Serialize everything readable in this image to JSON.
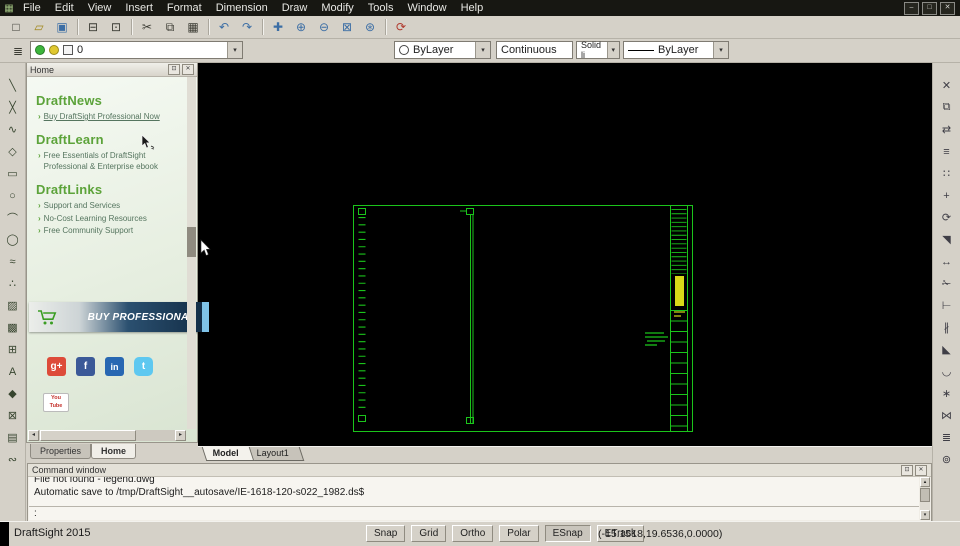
{
  "app": {
    "icon": "▦"
  },
  "menu": {
    "items": [
      "File",
      "Edit",
      "View",
      "Insert",
      "Format",
      "Dimension",
      "Draw",
      "Modify",
      "Tools",
      "Window",
      "Help"
    ]
  },
  "window_controls": {
    "minimize": "‒",
    "maximize": "□",
    "close": "✕"
  },
  "icons": {
    "new": "□",
    "open": "▱",
    "save": "▣",
    "print": "⊟",
    "print_preview": "⊡",
    "cut": "✂",
    "copy": "⧉",
    "paste": "▦",
    "undo": "↶",
    "redo": "↷",
    "pan": "✚",
    "zoom_in": "⊕",
    "zoom_out": "⊖",
    "zoom_window": "⊠",
    "zoom_fit": "⊛",
    "refresh": "⟳",
    "layers": "≣",
    "dropdown_arrow": "▾",
    "pin": "⊡",
    "close_small": "✕",
    "scroll_left": "◂",
    "scroll_right": "▸",
    "scroll_up": "▴",
    "scroll_down": "▾"
  },
  "toolbar2": {
    "layer_value": "0",
    "line_color": "ByLayer",
    "line_style": "Continuous",
    "line_weight": "Solid li",
    "line_pattern": "ByLayer"
  },
  "left_tools": [
    {
      "name": "line",
      "glyph": "╲"
    },
    {
      "name": "infinite-line",
      "glyph": "╳"
    },
    {
      "name": "polyline",
      "glyph": "∿"
    },
    {
      "name": "polygon",
      "glyph": "◇"
    },
    {
      "name": "rectangle",
      "glyph": "▭"
    },
    {
      "name": "circle",
      "glyph": "○"
    },
    {
      "name": "arc",
      "glyph": "⌒"
    },
    {
      "name": "ellipse",
      "glyph": "◯"
    },
    {
      "name": "spline",
      "glyph": "≈"
    },
    {
      "name": "point",
      "glyph": "∴"
    },
    {
      "name": "hatch",
      "glyph": "▨"
    },
    {
      "name": "region",
      "glyph": "▩"
    },
    {
      "name": "table",
      "glyph": "⊞"
    },
    {
      "name": "note",
      "glyph": "A"
    },
    {
      "name": "block",
      "glyph": "◆"
    },
    {
      "name": "insert-block",
      "glyph": "⊠"
    },
    {
      "name": "attach-image",
      "glyph": "▤"
    },
    {
      "name": "revision-cloud",
      "glyph": "∾"
    }
  ],
  "right_tools": [
    {
      "name": "erase",
      "glyph": "✕"
    },
    {
      "name": "copy",
      "glyph": "⧉"
    },
    {
      "name": "mirror",
      "glyph": "⇄"
    },
    {
      "name": "offset",
      "glyph": "≡"
    },
    {
      "name": "pattern",
      "glyph": "∷"
    },
    {
      "name": "move",
      "glyph": "+"
    },
    {
      "name": "rotate",
      "glyph": "⟳"
    },
    {
      "name": "scale",
      "glyph": "◥"
    },
    {
      "name": "stretch",
      "glyph": "↔"
    },
    {
      "name": "trim",
      "glyph": "✁"
    },
    {
      "name": "extend",
      "glyph": "⊢"
    },
    {
      "name": "break",
      "glyph": "∦"
    },
    {
      "name": "chamfer",
      "glyph": "◣"
    },
    {
      "name": "fillet",
      "glyph": "◡"
    },
    {
      "name": "explode",
      "glyph": "∗"
    },
    {
      "name": "join",
      "glyph": "⋈"
    },
    {
      "name": "properties",
      "glyph": "≣"
    },
    {
      "name": "options",
      "glyph": "⊚"
    }
  ],
  "home_panel": {
    "title": "Home",
    "bullet": "›",
    "sections": [
      {
        "heading": "DraftNews",
        "links": [
          "Buy DraftSight Professional Now"
        ]
      },
      {
        "heading": "DraftLearn",
        "links": [
          "Free Essentials of DraftSight Professional & Enterprise ebook"
        ]
      },
      {
        "heading": "DraftLinks",
        "links": [
          "Support and Services",
          "No-Cost Learning Resources",
          "Free Community Support"
        ]
      }
    ],
    "buy_button_label": "BUY PROFESSIONAL",
    "social": [
      "g+",
      "f",
      "in",
      "t",
      "You Tube"
    ],
    "tabs": [
      "Properties",
      "Home"
    ]
  },
  "canvas": {
    "tabs": [
      "Model",
      "Layout1"
    ]
  },
  "command_window": {
    "title": "Command window",
    "lines": [
      "File not found - legend.dwg",
      "Automatic save to /tmp/DraftSight__autosave/IE-1618-120-s022_1982.ds$"
    ],
    "prompt": ":"
  },
  "status_bar": {
    "app_name": "DraftSight 2015",
    "toggles": [
      "Snap",
      "Grid",
      "Ortho",
      "Polar",
      "ESnap",
      "ETrack"
    ],
    "coordinates": "(-15.1518,19.6536,0.0000)"
  },
  "colors": {
    "cad_line": "#1bc41b",
    "cad_highlight": "#d8d818",
    "accent_green": "#5ca33a"
  }
}
